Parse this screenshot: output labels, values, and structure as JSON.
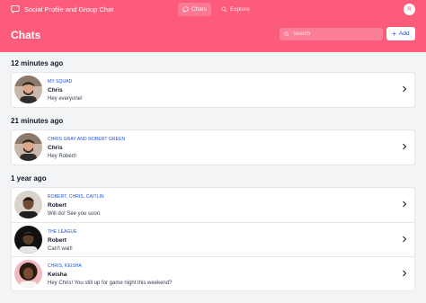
{
  "app": {
    "title": "Social Profile and Group Chat",
    "user_initial": "R"
  },
  "nav": {
    "chats": "Chats",
    "explore": "Explore"
  },
  "page": {
    "title": "Chats",
    "search_placeholder": "Search",
    "add_label": "Add"
  },
  "sections": [
    {
      "title": "12 minutes ago",
      "chats": [
        {
          "group": "MY SQUAD",
          "name": "Chris",
          "message": "Hey everyone!"
        }
      ]
    },
    {
      "title": "21 minutes ago",
      "chats": [
        {
          "group": "CHRIS GRAY AND ROBERT GREEN",
          "name": "Chris",
          "message": "Hey Robert!"
        }
      ]
    },
    {
      "title": "1 year ago",
      "chats": [
        {
          "group": "ROBERT, CHRIS, CAITLIN",
          "name": "Robert",
          "message": "Will do! See you soon."
        },
        {
          "group": "THE LEAGUE",
          "name": "Robert",
          "message": "Can't wait!"
        },
        {
          "group": "CHRIS, KEISHA",
          "name": "Keisha",
          "message": "Hey Chris! You still up for game night this weekend?"
        }
      ]
    }
  ],
  "colors": {
    "brand": "#fc5b7c",
    "accent": "#1d4ed8"
  }
}
